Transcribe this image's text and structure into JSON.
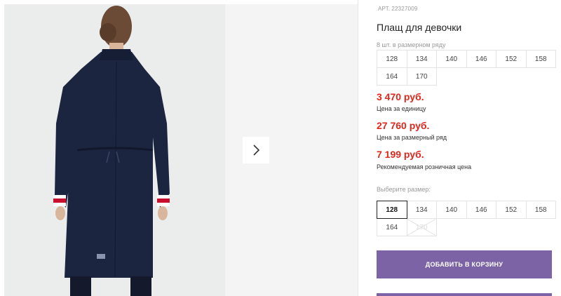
{
  "product": {
    "article_label": "АРТ.",
    "article_number": "22327009",
    "title": "Плащ для девочки"
  },
  "range": {
    "label": "8 шт. в размерном ряду",
    "sizes": [
      "128",
      "134",
      "140",
      "146",
      "152",
      "158",
      "164",
      "170"
    ]
  },
  "prices": [
    {
      "value": "3 470 руб.",
      "note": "Цена за единицу"
    },
    {
      "value": "27 760 руб.",
      "note": "Цена за размерный ряд"
    },
    {
      "value": "7 199 руб.",
      "note": "Рекомендуемая розничная цена"
    }
  ],
  "size_picker": {
    "label": "Выберите размер:",
    "sizes": [
      "128",
      "134",
      "140",
      "146",
      "152",
      "158",
      "164",
      "170"
    ],
    "selected": "128",
    "unavailable": [
      "170"
    ]
  },
  "actions": {
    "add_to_cart": "ДОБАВИТЬ В КОРЗИНУ"
  },
  "gallery": {
    "next_icon": "chevron-right-icon"
  },
  "colors": {
    "price": "#e1261c",
    "button": "#7c63a5",
    "coat": "#1c2540"
  }
}
